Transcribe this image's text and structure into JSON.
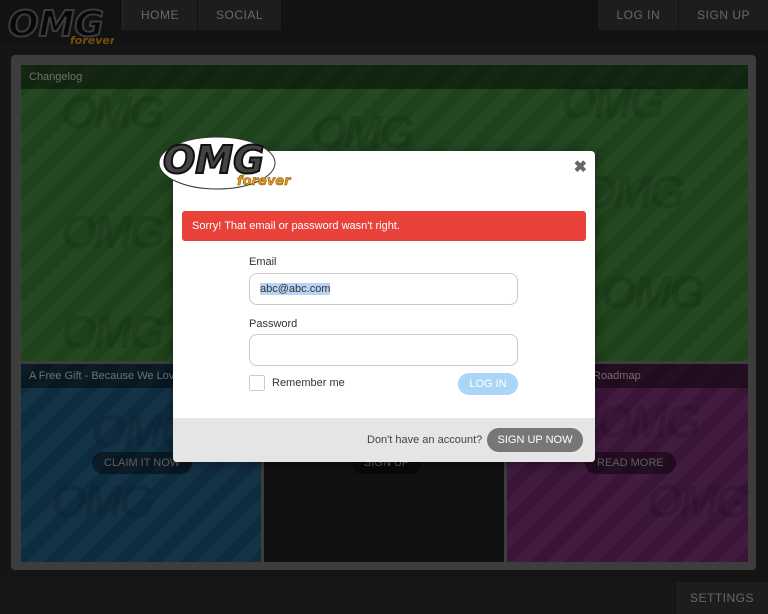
{
  "site": {
    "logo_text": "OMG",
    "logo_sub": "forever"
  },
  "nav": {
    "home": "HOME",
    "social": "SOCIAL",
    "login": "LOG IN",
    "signup": "SIGN UP",
    "settings": "SETTINGS"
  },
  "panels": {
    "changelog": {
      "title": "Changelog"
    },
    "gift": {
      "title": "A Free Gift - Because We Love",
      "button": "CLAIM IT NOW"
    },
    "signup_panel": {
      "button": "SIGN UP"
    },
    "roadmap": {
      "title": "Roadmap",
      "button": "READ MORE"
    }
  },
  "modal": {
    "error": "Sorry! That email or password wasn't right.",
    "email_label": "Email",
    "email_value": "abc@abc.com",
    "password_label": "Password",
    "password_value": "",
    "remember_label": "Remember me",
    "login_button": "LOG IN",
    "footer_text": "Don't have an account?",
    "signup_button": "SIGN UP NOW",
    "close_symbol": "✖"
  },
  "colors": {
    "error_red": "#e8423a",
    "login_blue": "#a9d6f7",
    "changelog_green": "#3f8a3b",
    "gift_blue": "#1f5e88",
    "roadmap_purple": "#7c2d77"
  }
}
